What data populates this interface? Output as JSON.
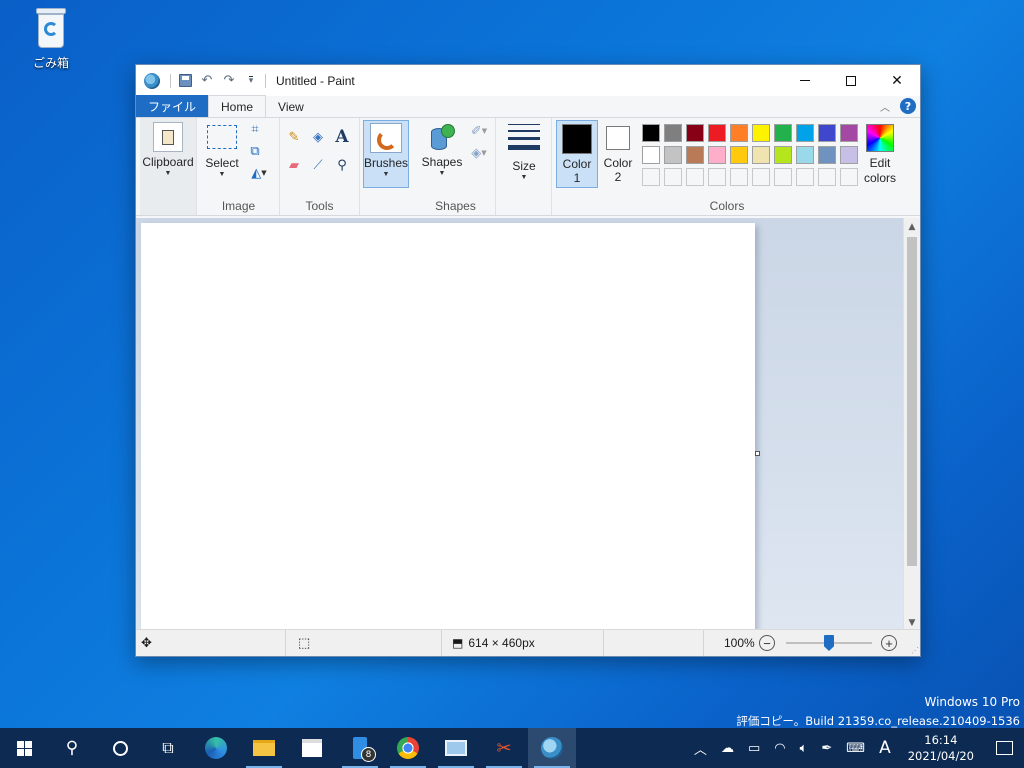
{
  "desktop": {
    "recycle_bin_label": "ごみ箱",
    "watermark_line1": "Windows 10 Pro",
    "watermark_line2": "評価コピー。Build 21359.co_release.210409-1536"
  },
  "window": {
    "title": "Untitled - Paint",
    "controls": {
      "minimize": "minimize",
      "maximize": "maximize",
      "close": "✕"
    }
  },
  "ribbon": {
    "tabs": [
      {
        "label": "ファイル",
        "active": false
      },
      {
        "label": "Home",
        "active": true
      },
      {
        "label": "View",
        "active": false
      }
    ],
    "groups": {
      "clipboard": {
        "button_label": "Clipboard"
      },
      "image": {
        "label": "Image",
        "select_label": "Select"
      },
      "tools": {
        "label": "Tools"
      },
      "brushes": {
        "label": "Brushes"
      },
      "shapes": {
        "label": "Shapes",
        "button_label": "Shapes"
      },
      "size": {
        "label": "Size"
      },
      "colors": {
        "label": "Colors",
        "color1_label": "Color\n1",
        "color1_line1": "Color",
        "color1_line2": "1",
        "color2_line1": "Color",
        "color2_line2": "2",
        "edit_line1": "Edit",
        "edit_line2": "colors",
        "color1": "#000000",
        "color2": "#ffffff",
        "palette_row1": [
          "#000000",
          "#7f7f7f",
          "#880015",
          "#ed1c24",
          "#ff7f27",
          "#fff200",
          "#22b14c",
          "#00a2e8",
          "#3f48cc",
          "#a349a4"
        ],
        "palette_row2": [
          "#ffffff",
          "#c3c3c3",
          "#b97a57",
          "#ffaec9",
          "#ffc90e",
          "#efe4b0",
          "#b5e61d",
          "#99d9ea",
          "#7092be",
          "#c8bfe7"
        ],
        "palette_row3_count": 10
      }
    }
  },
  "statusbar": {
    "canvas_size": "614 × 460px",
    "zoom": "100%",
    "zoom_level_fraction": 0.5
  },
  "taskbar": {
    "apps": [
      "start-icon",
      "search-icon",
      "cortana-icon",
      "task-view-icon",
      "edge-icon",
      "file-explorer-icon",
      "store-icon",
      "phone-app-icon",
      "chrome-icon",
      "remote-desktop-icon",
      "snipping-tool-icon",
      "paint-icon"
    ],
    "phone_badge": "8",
    "ime_indicator": "A",
    "time": "16:14",
    "date": "2021/04/20"
  }
}
